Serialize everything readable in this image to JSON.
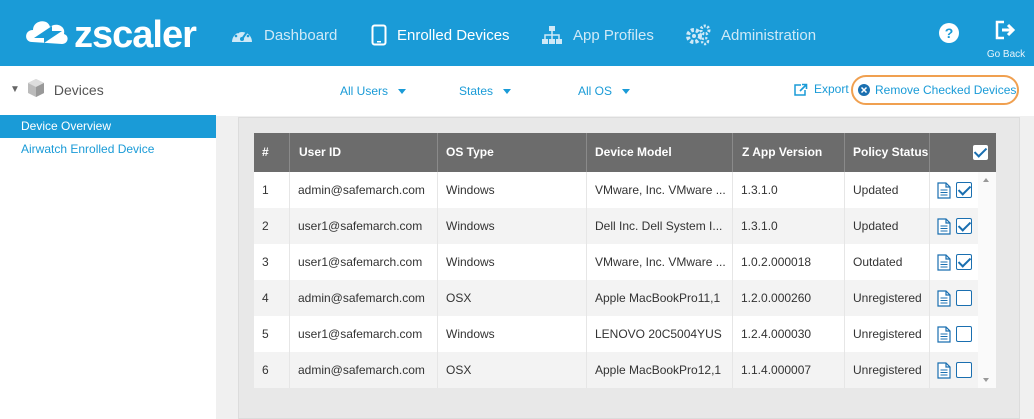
{
  "brand": {
    "name": "zscaler"
  },
  "nav": [
    {
      "label": "Dashboard",
      "icon": "gauge-icon",
      "active": false
    },
    {
      "label": "Enrolled Devices",
      "icon": "mobile-device-icon",
      "active": true
    },
    {
      "label": "App Profiles",
      "icon": "hierarchy-icon",
      "active": false
    },
    {
      "label": "Administration",
      "icon": "gears-icon",
      "active": false
    }
  ],
  "top_actions": {
    "help_icon": "question-icon",
    "back_label": "Go Back",
    "back_icon": "exit-icon"
  },
  "sidebar": {
    "title": "Devices",
    "items": [
      {
        "label": "Device Overview",
        "active": true
      },
      {
        "label": "Airwatch Enrolled Device",
        "active": false
      }
    ]
  },
  "toolbar": {
    "filters": [
      {
        "label": "All Users"
      },
      {
        "label": "States"
      },
      {
        "label": "All OS"
      }
    ],
    "export_label": "Export",
    "remove_label": "Remove Checked Devices"
  },
  "table": {
    "columns": [
      "#",
      "User ID",
      "OS Type",
      "Device Model",
      "Z App Version",
      "Policy Status"
    ],
    "header_checked": true,
    "rows": [
      {
        "num": "1",
        "user": "admin@safemarch.com",
        "os": "Windows",
        "model": "VMware, Inc. VMware ...",
        "version": "1.3.1.0",
        "status": "Updated",
        "checked": true
      },
      {
        "num": "2",
        "user": "user1@safemarch.com",
        "os": "Windows",
        "model": "Dell Inc. Dell System I...",
        "version": "1.3.1.0",
        "status": "Updated",
        "checked": true
      },
      {
        "num": "3",
        "user": "user1@safemarch.com",
        "os": "Windows",
        "model": "VMware, Inc. VMware ...",
        "version": "1.0.2.000018",
        "status": "Outdated",
        "checked": true
      },
      {
        "num": "4",
        "user": "admin@safemarch.com",
        "os": "OSX",
        "model": "Apple MacBookPro11,1",
        "version": "1.2.0.000260",
        "status": "Unregistered",
        "checked": false
      },
      {
        "num": "5",
        "user": "user1@safemarch.com",
        "os": "Windows",
        "model": "LENOVO 20C5004YUS",
        "version": "1.2.4.000030",
        "status": "Unregistered",
        "checked": false
      },
      {
        "num": "6",
        "user": "admin@safemarch.com",
        "os": "OSX",
        "model": "Apple MacBookPro12,1",
        "version": "1.1.4.000007",
        "status": "Unregistered",
        "checked": false
      }
    ]
  },
  "colors": {
    "accent": "#1a9bd7",
    "header_gray": "#6c6c6c",
    "highlight_ring": "#f0a050"
  }
}
